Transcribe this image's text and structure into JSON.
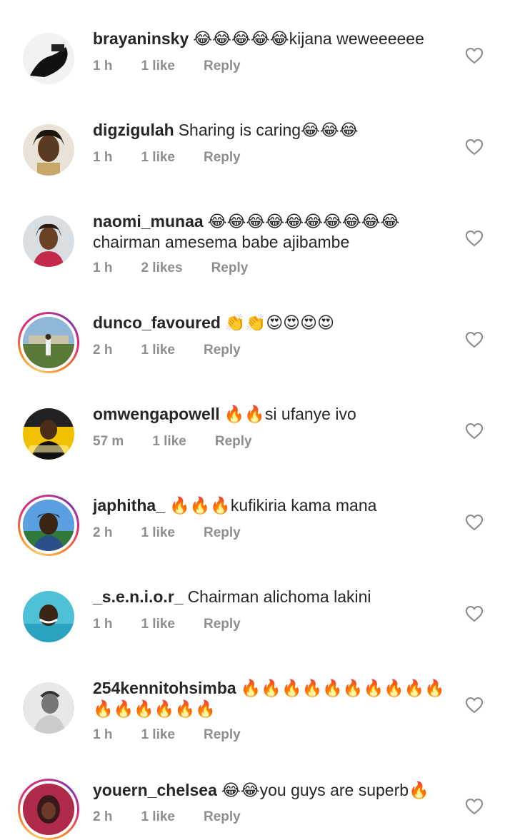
{
  "comments": [
    {
      "username": "brayaninsky",
      "text": "😂😂😂😂😂kijana weweeeeee",
      "time": "1 h",
      "likes": "1 like",
      "reply": "Reply",
      "story": false,
      "avatar_color": "#1a1a1a"
    },
    {
      "username": "digzigulah",
      "text": "Sharing is caring😂😂😂",
      "time": "1 h",
      "likes": "1 like",
      "reply": "Reply",
      "story": false,
      "avatar_color": "#7a5a3c"
    },
    {
      "username": "naomi_munaa",
      "text": "😂😂😂😂😂😂😂😂😂😂 chairman amesema babe ajibambe",
      "time": "1 h",
      "likes": "2 likes",
      "reply": "Reply",
      "story": false,
      "avatar_color": "#c23b5a"
    },
    {
      "username": "dunco_favoured",
      "text": "👏👏😍😍😍😍",
      "time": "2 h",
      "likes": "1 like",
      "reply": "Reply",
      "story": true,
      "avatar_color": "#5a8fb8"
    },
    {
      "username": "omwengapowell",
      "text": "🔥🔥si ufanye ivo",
      "time": "57 m",
      "likes": "1 like",
      "reply": "Reply",
      "story": false,
      "avatar_color": "#f2c100"
    },
    {
      "username": "japhitha_",
      "text": "🔥🔥🔥kufikiria kama mana",
      "time": "2 h",
      "likes": "1 like",
      "reply": "Reply",
      "story": true,
      "avatar_color": "#3a7fd0"
    },
    {
      "username": "_s.e.n.i.o.r_",
      "text": "Chairman alichoma lakini",
      "time": "1 h",
      "likes": "1 like",
      "reply": "Reply",
      "story": false,
      "avatar_color": "#4fc1d6"
    },
    {
      "username": "254kennitohsimba",
      "text": "🔥🔥🔥🔥🔥🔥🔥🔥🔥🔥🔥🔥🔥🔥🔥🔥",
      "time": "1 h",
      "likes": "1 like",
      "reply": "Reply",
      "story": false,
      "avatar_color": "#bdbdbd"
    },
    {
      "username": "youern_chelsea",
      "text": "😂😂you guys are superb🔥",
      "time": "2 h",
      "likes": "1 like",
      "reply": "Reply",
      "story": true,
      "avatar_color": "#b02a4a"
    }
  ],
  "icons": {
    "heart": "heart-outline-icon"
  }
}
